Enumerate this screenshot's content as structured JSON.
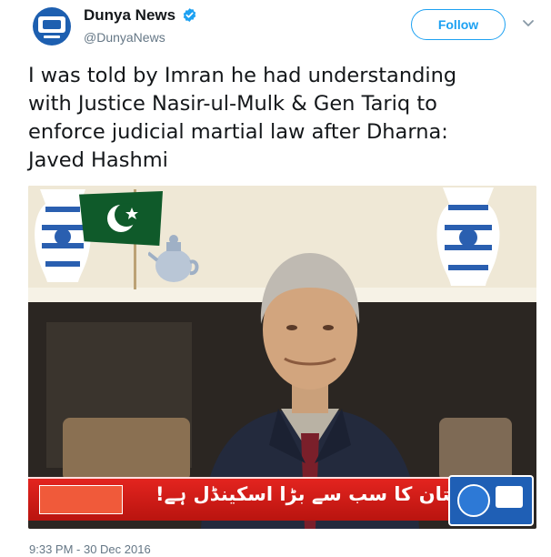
{
  "author": {
    "display_name": "Dunya News",
    "handle": "@DunyaNews",
    "verified_icon": "verified-badge-icon",
    "avatar_icon": "dunya-news-logo"
  },
  "actions": {
    "follow_label": "Follow",
    "menu_icon": "chevron-down-icon"
  },
  "tweet": {
    "text_lines": [
      "I was told by Imran he had understanding",
      "with Justice Nasir-ul-Mulk & Gen Tariq to",
      "enforce judicial martial law after Dharna:",
      "Javed Hashmi"
    ],
    "timestamp": "9:33 PM - 30 Dec 2016"
  },
  "media": {
    "ticker_text": "یہ پاکستان کا سب سے بڑا اسکینڈل ہے!"
  },
  "colors": {
    "accent": "#1da1f2",
    "text": "#14171a",
    "muted": "#657786",
    "ticker_red": "#d81e18",
    "dunya_blue": "#1f5fb5"
  }
}
